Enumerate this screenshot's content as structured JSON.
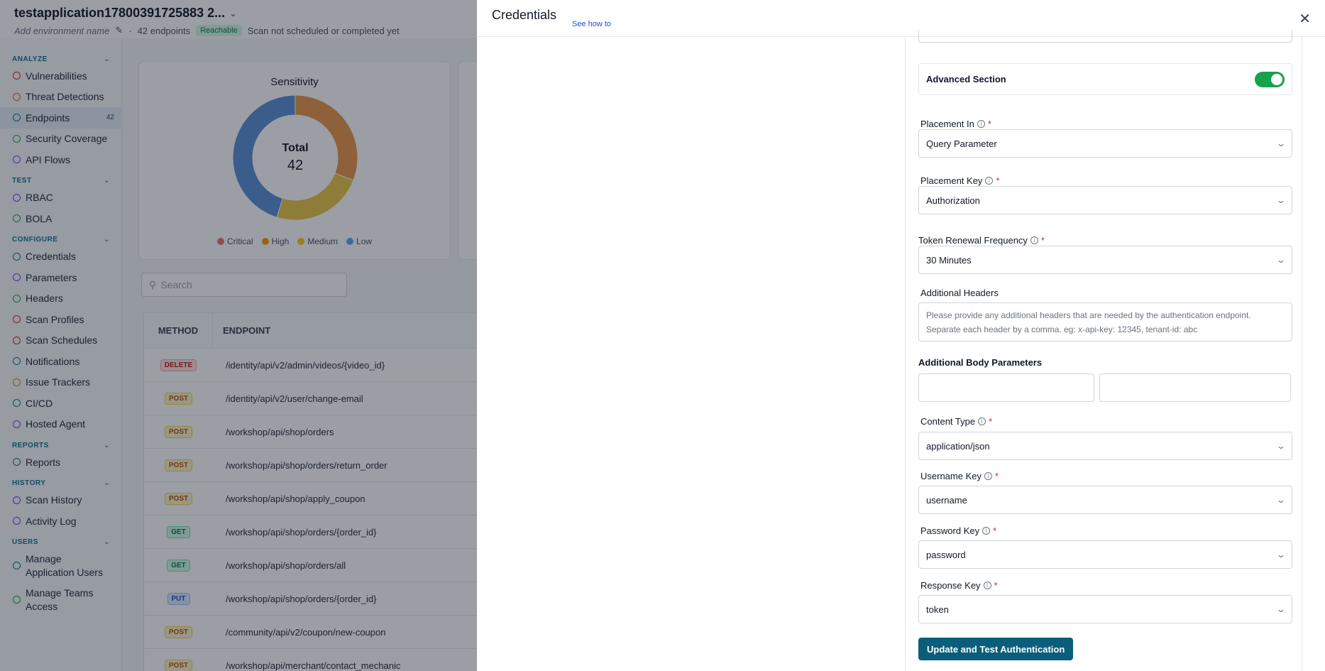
{
  "header": {
    "app_name": "testapplication17800391725883 2...",
    "env_placeholder": "Add environment name",
    "endpoints_count": "42 endpoints",
    "status_badge": "Reachable",
    "scan_status": "Scan not scheduled or completed yet"
  },
  "sidebar": {
    "sections": [
      {
        "title": "ANALYZE",
        "items": [
          {
            "label": "Vulnerabilities",
            "icon": "shield-alert-icon",
            "color": "#dc2626"
          },
          {
            "label": "Threat Detections",
            "icon": "radar-icon",
            "color": "#ea580c"
          },
          {
            "label": "Endpoints",
            "icon": "endpoints-icon",
            "color": "#0e7490",
            "count": "42",
            "active": true
          },
          {
            "label": "Security Coverage",
            "icon": "shield-check-icon",
            "color": "#16a34a"
          },
          {
            "label": "API Flows",
            "icon": "flow-icon",
            "color": "#7c3aed"
          }
        ]
      },
      {
        "title": "TEST",
        "items": [
          {
            "label": "RBAC",
            "icon": "users-icon",
            "color": "#7c3aed"
          },
          {
            "label": "BOLA",
            "icon": "shield-icon",
            "color": "#16a34a"
          }
        ]
      },
      {
        "title": "CONFIGURE",
        "items": [
          {
            "label": "Credentials",
            "icon": "key-icon",
            "color": "#0e7490"
          },
          {
            "label": "Parameters",
            "icon": "braces-icon",
            "color": "#7c3aed"
          },
          {
            "label": "Headers",
            "icon": "table-icon",
            "color": "#16a34a"
          },
          {
            "label": "Scan Profiles",
            "icon": "gauge-icon",
            "color": "#dc2626"
          },
          {
            "label": "Scan Schedules",
            "icon": "calendar-icon",
            "color": "#dc2626"
          },
          {
            "label": "Notifications",
            "icon": "bell-icon",
            "color": "#0e7490"
          },
          {
            "label": "Issue Trackers",
            "icon": "tracker-icon",
            "color": "#ca8a04"
          },
          {
            "label": "CI/CD",
            "icon": "cicd-icon",
            "color": "#0e7490"
          },
          {
            "label": "Hosted Agent",
            "icon": "agent-icon",
            "color": "#7c3aed"
          }
        ]
      },
      {
        "title": "REPORTS",
        "items": [
          {
            "label": "Reports",
            "icon": "report-icon",
            "color": "#0e7490"
          }
        ]
      },
      {
        "title": "HISTORY",
        "items": [
          {
            "label": "Scan History",
            "icon": "history-icon",
            "color": "#7c3aed"
          },
          {
            "label": "Activity Log",
            "icon": "log-icon",
            "color": "#7c3aed"
          }
        ]
      },
      {
        "title": "USERS",
        "items": [
          {
            "label": "Manage Application Users",
            "icon": "user-icon",
            "color": "#0e7490",
            "two_line": true
          },
          {
            "label": "Manage Teams Access",
            "icon": "team-icon",
            "color": "#16a34a",
            "two_line": true
          }
        ]
      }
    ]
  },
  "sensitivity": {
    "title": "Sensitivity",
    "total_label": "Total",
    "total_value": "42",
    "legend": [
      {
        "label": "Critical",
        "color": "#f87171"
      },
      {
        "label": "High",
        "color": "#f59e0b"
      },
      {
        "label": "Medium",
        "color": "#facc15"
      },
      {
        "label": "Low",
        "color": "#60a5fa"
      }
    ]
  },
  "chart_data": {
    "type": "pie",
    "title": "Sensitivity",
    "categories": [
      "Critical",
      "High",
      "Medium",
      "Low"
    ],
    "values": [
      0,
      13,
      10,
      19
    ],
    "colors": [
      "#f87171",
      "#e8964a",
      "#e8c547",
      "#5b8fd6"
    ]
  },
  "search": {
    "placeholder": "Search"
  },
  "table": {
    "headers": [
      "METHOD",
      "ENDPOINT"
    ],
    "rows": [
      {
        "method": "DELETE",
        "endpoint": "/identity/api/v2/admin/videos/{video_id}"
      },
      {
        "method": "POST",
        "endpoint": "/identity/api/v2/user/change-email"
      },
      {
        "method": "POST",
        "endpoint": "/workshop/api/shop/orders"
      },
      {
        "method": "POST",
        "endpoint": "/workshop/api/shop/orders/return_order"
      },
      {
        "method": "POST",
        "endpoint": "/workshop/api/shop/apply_coupon"
      },
      {
        "method": "GET",
        "endpoint": "/workshop/api/shop/orders/{order_id}"
      },
      {
        "method": "GET",
        "endpoint": "/workshop/api/shop/orders/all"
      },
      {
        "method": "PUT",
        "endpoint": "/workshop/api/shop/orders/{order_id}"
      },
      {
        "method": "POST",
        "endpoint": "/community/api/v2/coupon/new-coupon"
      },
      {
        "method": "POST",
        "endpoint": "/workshop/api/merchant/contact_mechanic"
      }
    ]
  },
  "drawer": {
    "title": "Credentials",
    "see_how": "See how to",
    "advanced_label": "Advanced Section",
    "advanced_enabled": true,
    "placement_in": {
      "label": "Placement In",
      "value": "Query Parameter"
    },
    "placement_key": {
      "label": "Placement Key",
      "value": "Authorization"
    },
    "renewal": {
      "label": "Token Renewal Frequency",
      "value": "30 Minutes"
    },
    "additional_headers": {
      "label": "Additional Headers",
      "placeholder": "Please provide any additional headers that are needed by the authentication endpoint. Separate each header by a comma. eg: x-api-key: 12345, tenant-id: abc"
    },
    "body_params_label": "Additional Body Parameters",
    "content_type": {
      "label": "Content Type",
      "value": "application/json"
    },
    "username_key": {
      "label": "Username Key",
      "value": "username"
    },
    "password_key": {
      "label": "Password Key",
      "value": "password"
    },
    "response_key": {
      "label": "Response Key",
      "value": "token"
    },
    "submit_label": "Update and Test Authentication"
  }
}
